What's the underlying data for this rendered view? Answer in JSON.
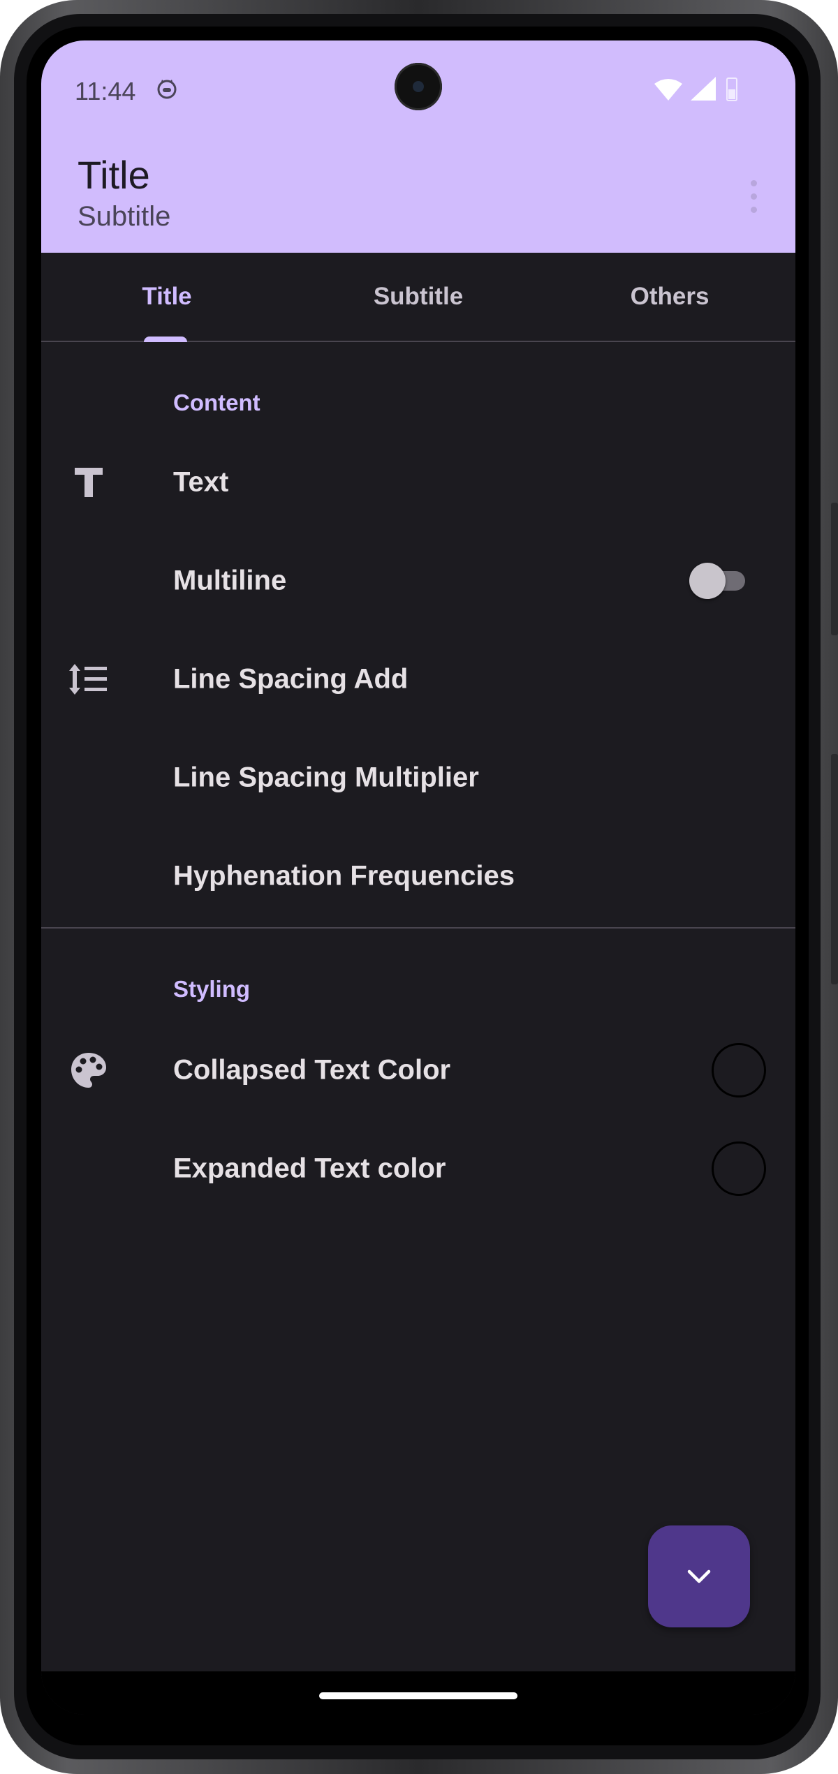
{
  "status_bar": {
    "time": "11:44"
  },
  "app_bar": {
    "title": "Title",
    "subtitle": "Subtitle"
  },
  "tabs": [
    {
      "label": "Title",
      "selected": true
    },
    {
      "label": "Subtitle",
      "selected": false
    },
    {
      "label": "Others",
      "selected": false
    }
  ],
  "content": {
    "header": "Content",
    "items": [
      {
        "label": "Text",
        "icon": "text-format-icon"
      },
      {
        "label": "Multiline",
        "switch_on": false
      },
      {
        "label": "Line Spacing Add",
        "icon": "line-spacing-icon"
      },
      {
        "label": "Line Spacing Multiplier"
      },
      {
        "label": "Hyphenation Frequencies"
      }
    ]
  },
  "styling": {
    "header": "Styling",
    "items": [
      {
        "label": "Collapsed Text Color",
        "icon": "palette-icon",
        "swatch": "#000000"
      },
      {
        "label": "Expanded Text color",
        "swatch": "#000000"
      }
    ]
  },
  "colors": {
    "app_bar_bg": "#d1bcfd",
    "background": "#1c1b20",
    "accent": "#d0bcff",
    "fab_bg": "#4f378b"
  },
  "fab": {
    "icon": "chevron-down-icon"
  }
}
